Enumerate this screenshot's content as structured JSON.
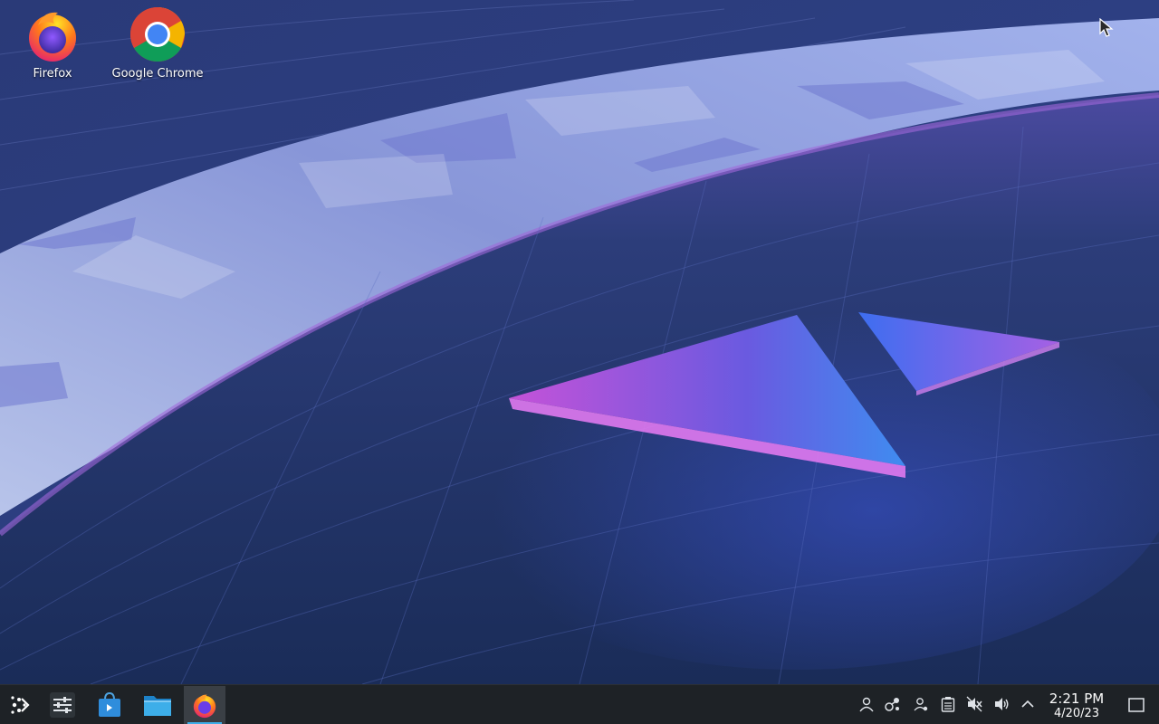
{
  "desktop": {
    "icons": [
      {
        "label": "Firefox",
        "icon": "firefox-icon"
      },
      {
        "label": "Google Chrome",
        "icon": "chrome-icon"
      }
    ]
  },
  "taskbar": {
    "launcher_icon": "application-launcher-icon",
    "pinned": [
      {
        "name": "system-settings",
        "icon": "settings-sliders-icon"
      },
      {
        "name": "discover",
        "icon": "shopping-bag-icon"
      },
      {
        "name": "dolphin",
        "icon": "folder-icon"
      },
      {
        "name": "firefox",
        "icon": "firefox-icon",
        "active": true
      }
    ],
    "tray": [
      {
        "name": "user-icon"
      },
      {
        "name": "network-icon"
      },
      {
        "name": "accounts-icon"
      },
      {
        "name": "clipboard-icon"
      },
      {
        "name": "mic-muted-icon"
      },
      {
        "name": "volume-icon"
      },
      {
        "name": "expand-tray-icon"
      }
    ],
    "clock": {
      "time": "2:21 PM",
      "date": "4/20/23"
    }
  },
  "colors": {
    "taskbar_bg": "#1e2226",
    "accent": "#3daee9"
  }
}
